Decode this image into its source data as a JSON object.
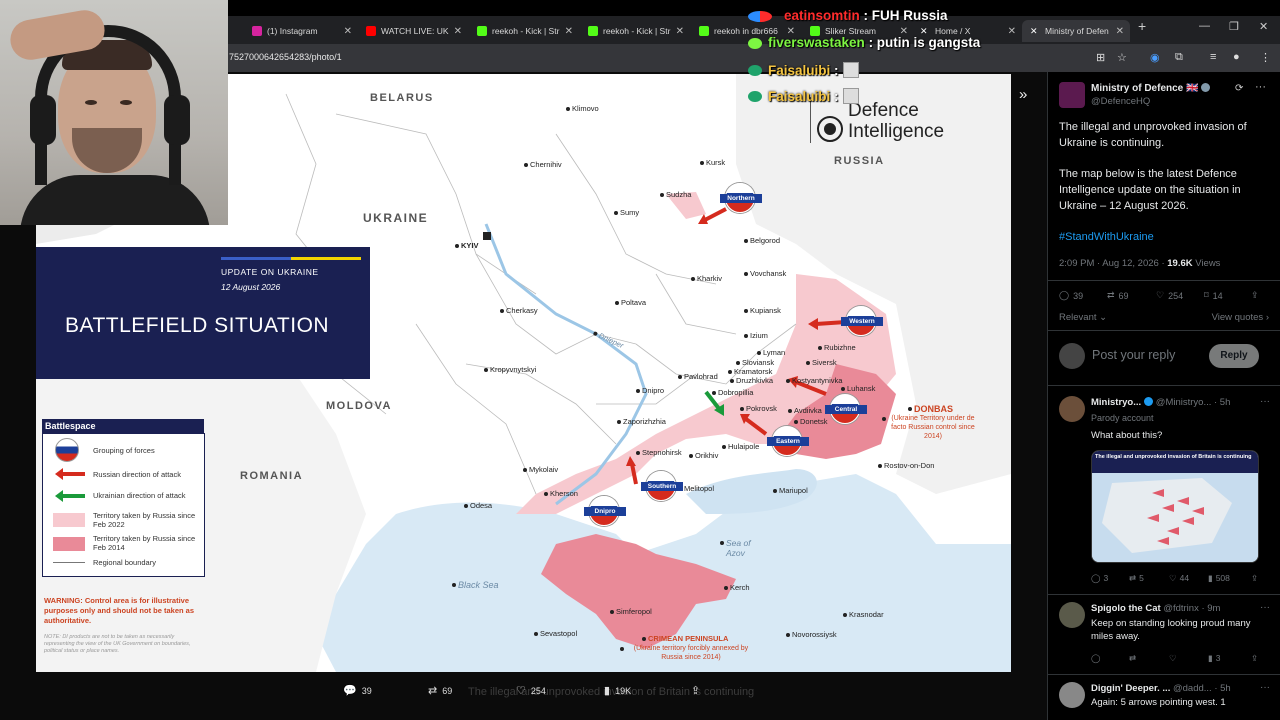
{
  "browser": {
    "tabs": [
      {
        "label": "(1) Instagram",
        "color": "#d6249f"
      },
      {
        "label": "WATCH LIVE: UK",
        "color": "#ff0000"
      },
      {
        "label": "reekoh - Kick | Str",
        "color": "#53fc18"
      },
      {
        "label": "reekoh - Kick | Str",
        "color": "#53fc18"
      },
      {
        "label": "reekoh in dbr666",
        "color": "#53fc18"
      },
      {
        "label": "Sliker Stream",
        "color": "#53fc18"
      },
      {
        "label": "Home / X",
        "color": "#ffffff"
      },
      {
        "label": "Ministry of Defen",
        "color": "#ffffff"
      }
    ],
    "new_tab": "+",
    "url": "7527000642654283/photo/1"
  },
  "viewer": {
    "stats": {
      "replies": "39",
      "reposts": "69",
      "likes": "254",
      "views": "19K"
    },
    "ghost_text": "The illegal and unprovoked invasion of Britain is continuing"
  },
  "map": {
    "countries": [
      "BELARUS",
      "UKRAINE",
      "RUSSIA",
      "MOLDOVA",
      "ROMANIA"
    ],
    "seas": [
      "Black Sea",
      "Sea of Azov"
    ],
    "river": "Dnieper",
    "capital": "KYIV",
    "cities": [
      "Klimovo",
      "Chernihiv",
      "Kursk",
      "Sudzha",
      "Sumy",
      "Belgorod",
      "Vovchansk",
      "Kharkiv",
      "Poltava",
      "Cherkasy",
      "Kupiansk",
      "Izium",
      "Lyman",
      "Rubizhne",
      "Sloviansk",
      "Kramatorsk",
      "Siversk",
      "Druzhkivka",
      "Kostyantynivka",
      "Luhansk",
      "Kropyvnytskyi",
      "Pavlohrad",
      "Dobropillia",
      "Dnipro",
      "Pokrovsk",
      "Avdiivka",
      "Donetsk",
      "Zaporizhzhia",
      "Hulaipole",
      "Stepnohirsk",
      "Orikhiv",
      "Mykolaiv",
      "Kherson",
      "Odesa",
      "Melitopol",
      "Mariupol",
      "Rostov-on-Don",
      "Kerch",
      "Simferopol",
      "Sevastopol",
      "Novorossiysk",
      "Krasnodar"
    ],
    "groupings": [
      "Northern",
      "Western",
      "Central",
      "Eastern",
      "Southern",
      "Dnipro"
    ],
    "donbas_title": "DONBAS",
    "donbas_note": "(Ukraine Territory under de facto Russian control since 2014)",
    "crimea_title": "CRIMEAN PENINSULA",
    "crimea_note": "(Ukraine territory forcibly annexed by Russia since 2014)",
    "logo_line1": "Defence",
    "logo_line2": "Intelligence",
    "title_card": {
      "update": "UPDATE ON UKRAINE",
      "date": "12 August 2026",
      "title": "BATTLEFIELD SITUATION"
    },
    "legend": {
      "title": "Battlespace",
      "items": [
        "Grouping of forces",
        "Russian direction of attack",
        "Ukrainian direction of attack",
        "Territory taken by Russia since Feb 2022",
        "Territory taken by Russia since Feb 2014",
        "Regional boundary"
      ]
    },
    "warning": "WARNING: Control area is for illustrative purposes only and should not be taken as authoritative.",
    "note": "NOTE: DI products are not to be taken as necessarily representing the view of the UK Government on boundaries, political status or place names."
  },
  "tweet": {
    "author": "Ministry of Defence 🇬🇧",
    "handle": "@DefenceHQ",
    "text1": "The illegal and unprovoked invasion of Ukraine is continuing.",
    "text2": "The map below is the latest Defence Intelligence update on the situation in Ukraine – 12 August 2026.",
    "hashtag": "#StandWithUkraine",
    "time": "2:09 PM · Aug 12, 2026 · ",
    "views_count": "19.6K",
    "views_label": " Views",
    "stats": {
      "replies": "39",
      "reposts": "69",
      "likes": "254",
      "bookmarks": "14"
    },
    "relevant": "Relevant",
    "view_quotes": "View quotes",
    "reply_placeholder": "Post your reply",
    "reply_button": "Reply"
  },
  "comments": [
    {
      "name": "Ministryo...",
      "handle": "@Ministryo... · 5h",
      "sub": "Parody account",
      "text": "What about this?",
      "thumb_title": "The illegal and unprovoked invasion of Britain is continuing",
      "stats": {
        "replies": "3",
        "reposts": "5",
        "likes": "44",
        "views": "508"
      }
    },
    {
      "name": "Spigolo the Cat",
      "handle": "@fdtrinx · 9m",
      "text": "Keep on standing looking proud many miles away.",
      "stats": {
        "views": "3"
      }
    },
    {
      "name": "Diggin' Deeper. ...",
      "handle": "@dadd... · 5h",
      "text": "Again: 5 arrows pointing west. 1"
    }
  ],
  "chat": [
    {
      "user": "eatinsomtin",
      "msg": " : FUH Russia",
      "color": "#ff2c2c"
    },
    {
      "user": "fiverswastaken",
      "msg": " : putin is gangsta",
      "color": "#7df542"
    },
    {
      "user": "Faisaluibi",
      "msg": " :",
      "color": "#f5c542"
    },
    {
      "user": "Faisaluibi",
      "msg": " :",
      "color": "#f5c542"
    }
  ]
}
